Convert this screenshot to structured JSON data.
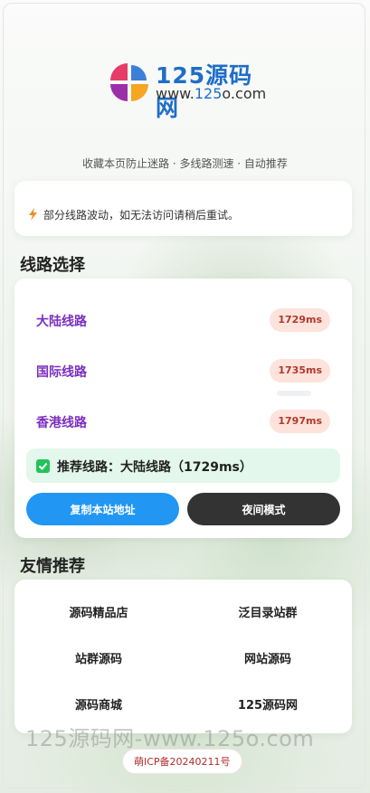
{
  "logo": {
    "name": "125源码网",
    "url_prefix": "www.",
    "url_number": "125",
    "url_suffix": "o.com",
    "colors": [
      "#e63c6a",
      "#f5a623",
      "#3b7fd9",
      "#9b2fa8"
    ]
  },
  "tagline": "收藏本页防止迷路 · 多线路测速 · 自动推荐",
  "notice": {
    "icon": "lightning-icon",
    "text": "部分线路波动，如无法访问请稍后重试。"
  },
  "routes": {
    "title": "线路选择",
    "items": [
      {
        "name": "大陆线路",
        "latency": "1729ms"
      },
      {
        "name": "国际线路",
        "latency": "1735ms"
      },
      {
        "name": "香港线路",
        "latency": "1797ms"
      }
    ],
    "recommend_text": "推荐线路：大陆线路（1729ms）",
    "copy_button": "复制本站地址",
    "night_button": "夜间模式"
  },
  "friends": {
    "title": "友情推荐",
    "links": [
      "源码精品店",
      "泛目录站群",
      "站群源码",
      "网站源码",
      "源码商城",
      "125源码网"
    ]
  },
  "watermark": "125源码网-www.125o.com",
  "icp": "萌ICP备20240211号",
  "colors": {
    "accent_blue": "#2196f3",
    "route_purple": "#7b2fbe",
    "latency_bg": "#fde3db",
    "recommend_bg": "#e3f7ec",
    "check_green": "#21c35a"
  }
}
